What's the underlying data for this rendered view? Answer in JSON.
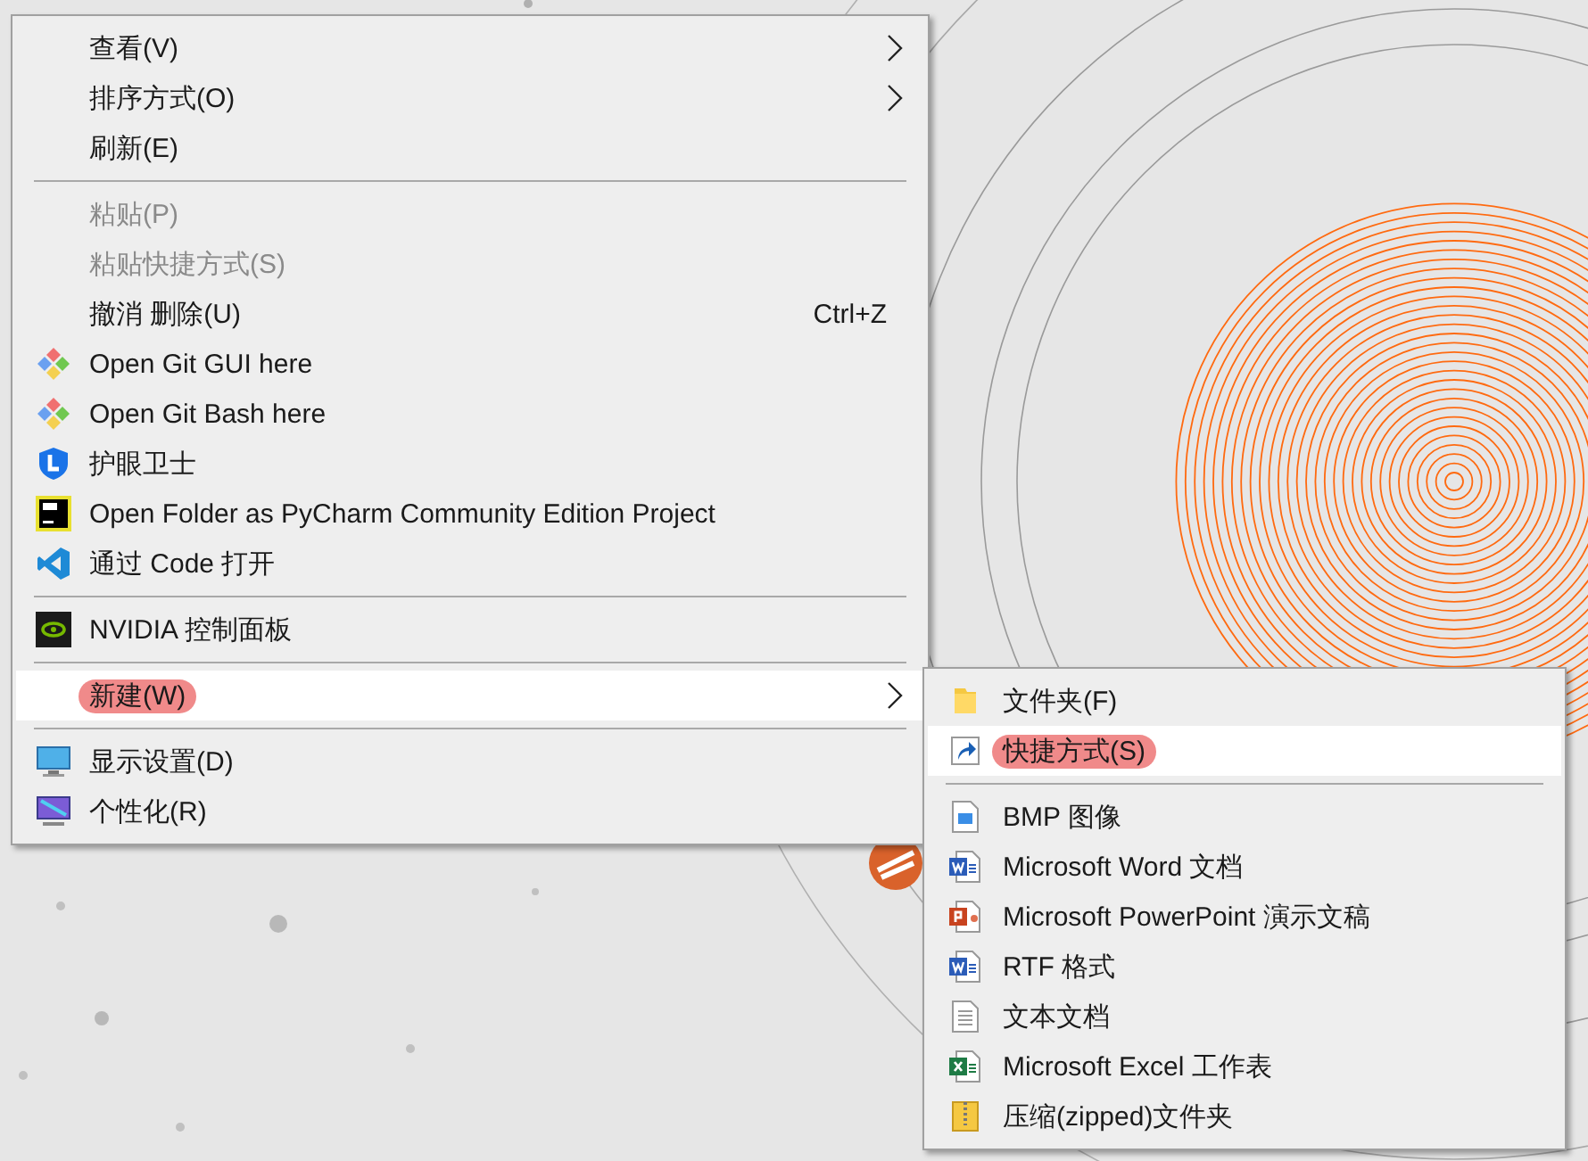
{
  "context_menu": {
    "items": [
      {
        "kind": "item",
        "label": "查看(V)",
        "submenu": true,
        "disabled": false,
        "selected": false,
        "marked": false
      },
      {
        "kind": "item",
        "label": "排序方式(O)",
        "submenu": true,
        "disabled": false,
        "selected": false,
        "marked": false
      },
      {
        "kind": "item",
        "label": "刷新(E)",
        "submenu": false,
        "disabled": false,
        "selected": false,
        "marked": false
      },
      {
        "kind": "separator"
      },
      {
        "kind": "item",
        "label": "粘贴(P)",
        "submenu": false,
        "disabled": true,
        "selected": false,
        "marked": false
      },
      {
        "kind": "item",
        "label": "粘贴快捷方式(S)",
        "submenu": false,
        "disabled": true,
        "selected": false,
        "marked": false
      },
      {
        "kind": "item",
        "label": "撤消 删除(U)",
        "shortcut": "Ctrl+Z",
        "submenu": false,
        "disabled": false,
        "selected": false,
        "marked": false
      },
      {
        "kind": "item",
        "label": "Open Git GUI here",
        "submenu": false,
        "disabled": false,
        "selected": false,
        "marked": false
      },
      {
        "kind": "item",
        "label": "Open Git Bash here",
        "submenu": false,
        "disabled": false,
        "selected": false,
        "marked": false
      },
      {
        "kind": "item",
        "label": "护眼卫士",
        "submenu": false,
        "disabled": false,
        "selected": false,
        "marked": false
      },
      {
        "kind": "item",
        "label": "Open Folder as PyCharm Community Edition Project",
        "submenu": false,
        "disabled": false,
        "selected": false,
        "marked": false
      },
      {
        "kind": "item",
        "label": "通过 Code 打开",
        "submenu": false,
        "disabled": false,
        "selected": false,
        "marked": false
      },
      {
        "kind": "separator"
      },
      {
        "kind": "item",
        "label": "NVIDIA 控制面板",
        "submenu": false,
        "disabled": false,
        "selected": false,
        "marked": false
      },
      {
        "kind": "separator"
      },
      {
        "kind": "item",
        "label": "新建(W)",
        "submenu": true,
        "disabled": false,
        "selected": true,
        "marked": true
      },
      {
        "kind": "separator"
      },
      {
        "kind": "item",
        "label": "显示设置(D)",
        "submenu": false,
        "disabled": false,
        "selected": false,
        "marked": false
      },
      {
        "kind": "item",
        "label": "个性化(R)",
        "submenu": false,
        "disabled": false,
        "selected": false,
        "marked": false
      }
    ]
  },
  "new_submenu": {
    "items": [
      {
        "kind": "item",
        "label": "文件夹(F)",
        "selected": false,
        "marked": false
      },
      {
        "kind": "item",
        "label": "快捷方式(S)",
        "selected": true,
        "marked": true
      },
      {
        "kind": "separator"
      },
      {
        "kind": "item",
        "label": "BMP 图像",
        "selected": false,
        "marked": false
      },
      {
        "kind": "item",
        "label": "Microsoft Word 文档",
        "selected": false,
        "marked": false
      },
      {
        "kind": "item",
        "label": "Microsoft PowerPoint 演示文稿",
        "selected": false,
        "marked": false
      },
      {
        "kind": "item",
        "label": "RTF 格式",
        "selected": false,
        "marked": false
      },
      {
        "kind": "item",
        "label": "文本文档",
        "selected": false,
        "marked": false
      },
      {
        "kind": "item",
        "label": "Microsoft Excel 工作表",
        "selected": false,
        "marked": false
      },
      {
        "kind": "item",
        "label": "压缩(zipped)文件夹",
        "selected": false,
        "marked": false
      }
    ]
  }
}
